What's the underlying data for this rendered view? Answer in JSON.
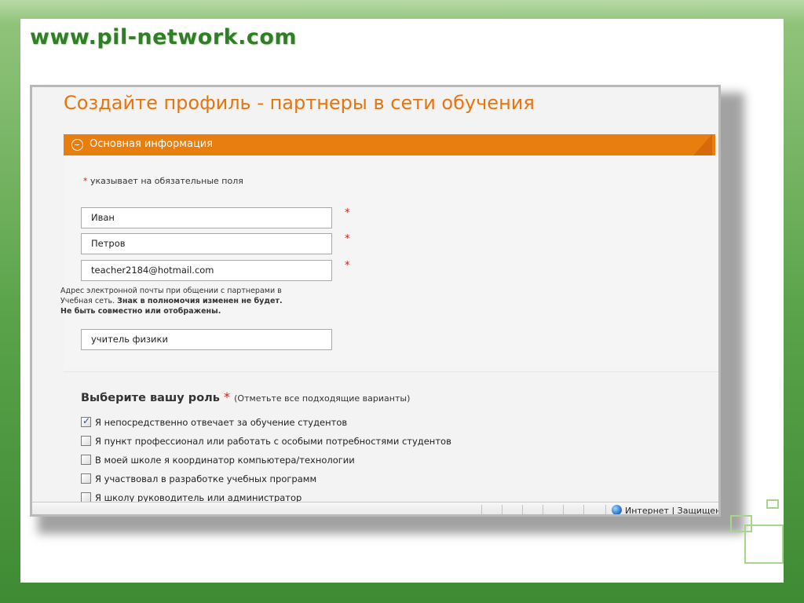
{
  "site": {
    "url": "www.pil-network.com"
  },
  "page": {
    "title": "Создайте профиль - партнеры в сети обучения"
  },
  "section": {
    "label": "Основная информация"
  },
  "form": {
    "required_note": "указывает на обязательные поля",
    "required_mark": "*",
    "first_name": "Иван",
    "last_name": "Петров",
    "email": "teacher2184@hotmail.com",
    "email_help": {
      "line1": "Адрес электронной почты при общении с партнерами в",
      "line2_plain": "Учебная сеть. ",
      "line2_bold": "Знак в полномочия изменен не будет.",
      "line3_bold": "Не быть совместно или отображены."
    },
    "position": "учитель физики"
  },
  "roles": {
    "heading": "Выберите вашу роль",
    "hint": "(Отметьте все подходящие варианты)",
    "items": [
      {
        "label": "Я непосредственно отвечает за обучение студентов",
        "checked": true
      },
      {
        "label": "Я пункт профессионал или работать с особыми потребностями студентов",
        "checked": false
      },
      {
        "label": "В моей школе я координатор компьютера/технологии",
        "checked": false
      },
      {
        "label": "Я участвовал в разработке учебных программ",
        "checked": false
      },
      {
        "label": "Я школу руководитель или администратор",
        "checked": false
      }
    ]
  },
  "statusbar": {
    "zone": "Интернет | Защищен"
  },
  "colors": {
    "accent": "#e87e0d",
    "title": "#e8740e",
    "url": "#2f7f24"
  }
}
